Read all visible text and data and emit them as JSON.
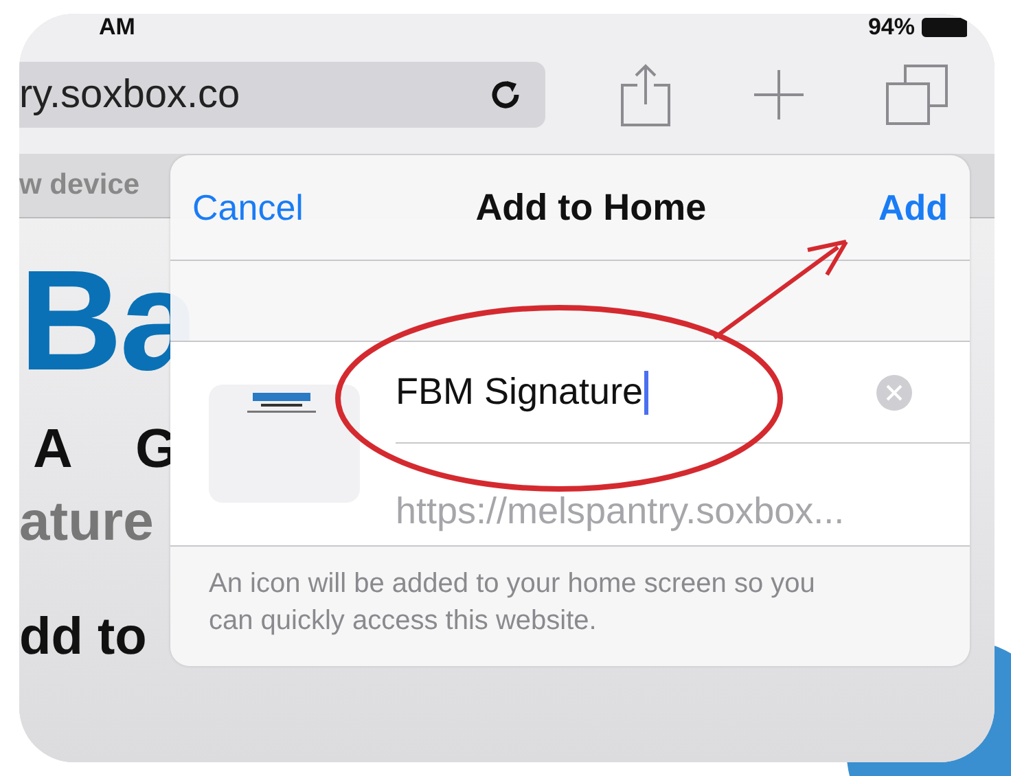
{
  "status_bar": {
    "time": "AM",
    "battery": "94%"
  },
  "toolbar": {
    "url": "ry.soxbox.co"
  },
  "page": {
    "tab_label": "w device",
    "logo_text": "Ba",
    "logo_subtitle": "A G",
    "tagline": "ature",
    "heading": "dd to"
  },
  "dialog": {
    "title": "Add to Home",
    "cancel": "Cancel",
    "confirm": "Add",
    "name_value": "FBM Signature",
    "url": "https://melspantry.soxbox...",
    "footer": "An icon will be added to your home screen so you can quickly access this website."
  }
}
